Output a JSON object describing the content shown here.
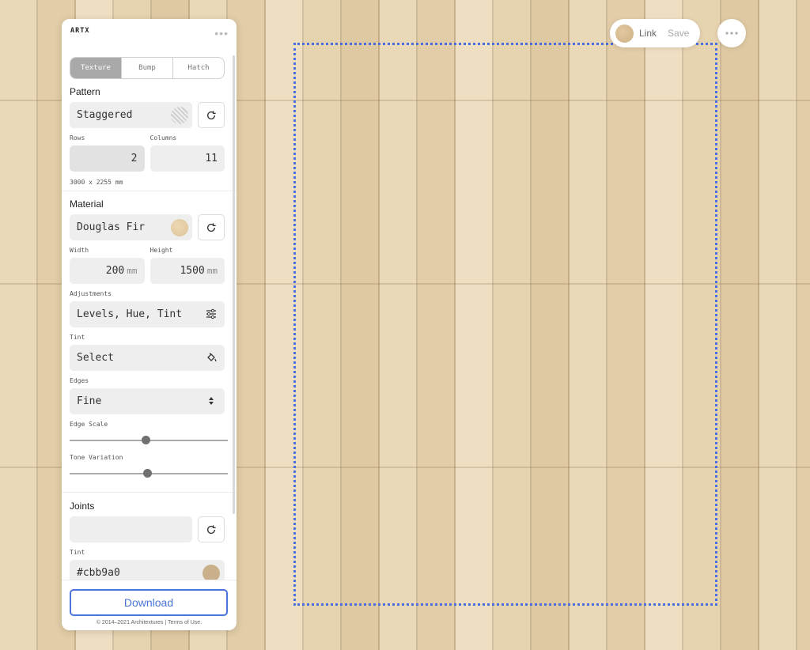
{
  "app": {
    "logo_text": "ARTX"
  },
  "tabs": [
    {
      "label": "Texture",
      "active": true
    },
    {
      "label": "Bump",
      "active": false
    },
    {
      "label": "Hatch",
      "active": false
    }
  ],
  "pattern": {
    "title": "Pattern",
    "value": "Staggered",
    "rows_label": "Rows",
    "rows": "2",
    "columns_label": "Columns",
    "columns": "11",
    "dimensions": "3000 x 2255 mm"
  },
  "material": {
    "title": "Material",
    "value": "Douglas Fir",
    "width_label": "Width",
    "width": "200",
    "height_label": "Height",
    "height": "1500",
    "unit": "mm",
    "adjustments_label": "Adjustments",
    "adjustments": "Levels, Hue, Tint",
    "tint_label": "Tint",
    "tint": "Select",
    "edges_label": "Edges",
    "edges": "Fine",
    "edge_scale_label": "Edge Scale",
    "edge_scale": 0.49,
    "tone_variation_label": "Tone Variation",
    "tone_variation": 0.5
  },
  "joints": {
    "title": "Joints",
    "value": "",
    "tint_label": "Tint",
    "tint": "#cbb9a0"
  },
  "footer": {
    "download": "Download",
    "copyright": "© 2014–2021 Architextures | ",
    "terms": "Terms of Use."
  },
  "topbar": {
    "link": "Link",
    "save": "Save"
  },
  "colors": {
    "accent": "#4a74d9",
    "selection": "#4a6ee0",
    "joint_tint": "#cbb9a0"
  },
  "icons": [
    "refresh-icon",
    "sliders-icon",
    "paint-bucket-icon",
    "select-arrows-icon",
    "more-icon"
  ]
}
